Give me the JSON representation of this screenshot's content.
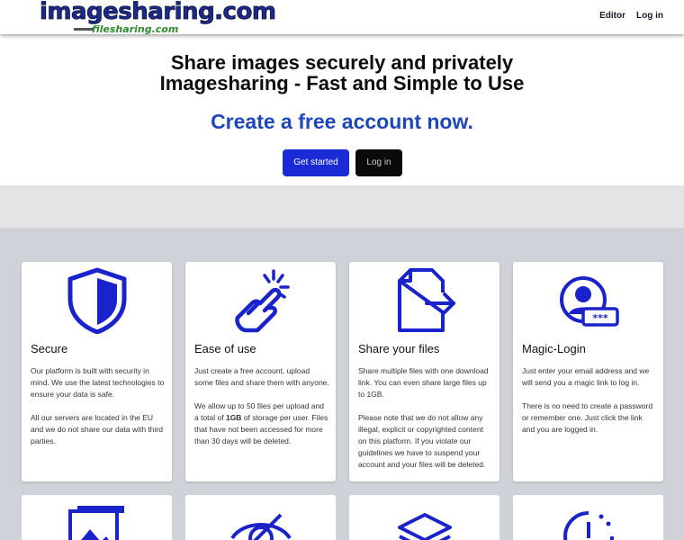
{
  "nav": {
    "logo_main": "imagesharing.com",
    "logo_sub": "filesharing.com",
    "links": [
      "Editor",
      "Log in"
    ]
  },
  "hero": {
    "line1": "Share images securely and privately",
    "line2": "Imagesharing - Fast and Simple to Use",
    "cta": "Create a free account now.",
    "get_started": "Get started",
    "login": "Log in"
  },
  "features": [
    {
      "icon": "shield-icon",
      "title": "Secure",
      "paragraphs": [
        "Our platform is built with security in mind. We use the latest technologies to ensure your data is safe.",
        "All our servers are located in the EU and we do not share our data with third parties."
      ]
    },
    {
      "icon": "tap-hand-icon",
      "title": "Ease of use",
      "paragraphs": [
        "Just create a free account, upload some files and share them with anyone.",
        "We allow up to 50 files per upload and a total of 1GB of storage per user. Files that have not been accessed for more than 30 days will be deleted."
      ]
    },
    {
      "icon": "file-share-icon",
      "title": "Share your files",
      "paragraphs": [
        "Share multiple files with one download link. You can even share large files up to 1GB.",
        "Please note that we do not allow any illegal, explicit or copyrighted content on this platform. If you violate our guidelines we have to suspend your account and your files will be deleted."
      ]
    },
    {
      "icon": "user-password-icon",
      "title": "Magic-Login",
      "paragraphs": [
        "Just enter your email address and we will send you a magic link to log in.",
        "There is no need to create a password or remember one. Just click the link and you are logged in."
      ]
    }
  ],
  "second_row_icons": [
    "image-icon",
    "eye-icon",
    "layers-icon",
    "clock-icon"
  ],
  "colors": {
    "accent": "#1a2bd6",
    "cta_text": "#1f47b8",
    "icon_blue": "#1a23c9",
    "features_bg": "#cfd2d8"
  }
}
